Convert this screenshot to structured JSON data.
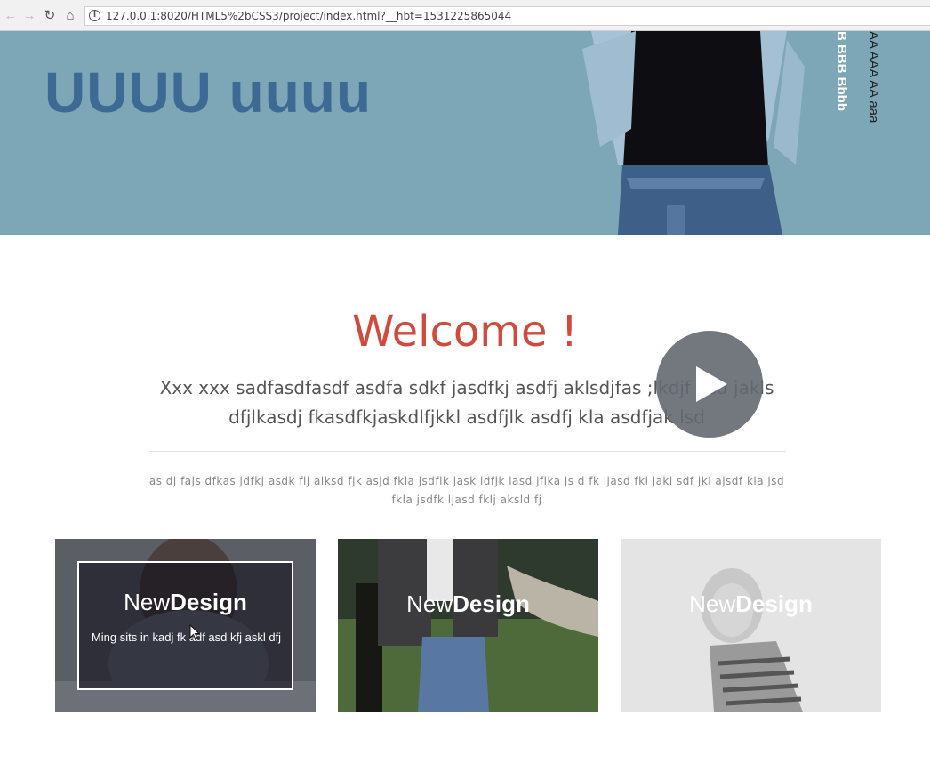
{
  "browser": {
    "url": "127.0.0.1:8020/HTML5%2bCSS3/project/index.html?__hbt=1531225865044"
  },
  "hero": {
    "title": "UUUU uuuu",
    "vertical_text_white": "B BBB Bbbb",
    "vertical_text_dark": "AA AAA AA aaa",
    "bg_color": "#7da6b7",
    "title_color": "#3c6a95"
  },
  "welcome": {
    "heading": "Welcome !",
    "lead": "Xxx xxx sadfasdfasdf asdfa sdkf jasdfkj asdfj aklsdjfas ;lkdjf asd jakls dfjlkasdj fkasdfkjaskdlfjkkl asdfjlk asdfj kla asdfjak lsd",
    "small": "as dj fajs dfkas jdfkj asdk flj alksd fjk asjd fkla jsdflk jask ldfjk lasd jflka js d fk ljasd fkl jakl sdf jkl ajsdf kla jsd fkla jsdfk ljasd fklj aksld fj",
    "heading_color": "#d24a3c"
  },
  "video": {
    "icon": "play-icon"
  },
  "cards": [
    {
      "title_light": "New",
      "title_bold": "Design",
      "desc": "Ming sits in kadj fk adf asd kfj askl dfj"
    },
    {
      "title_light": "New",
      "title_bold": "Design"
    },
    {
      "title_light": "New",
      "title_bold": "Design"
    }
  ]
}
